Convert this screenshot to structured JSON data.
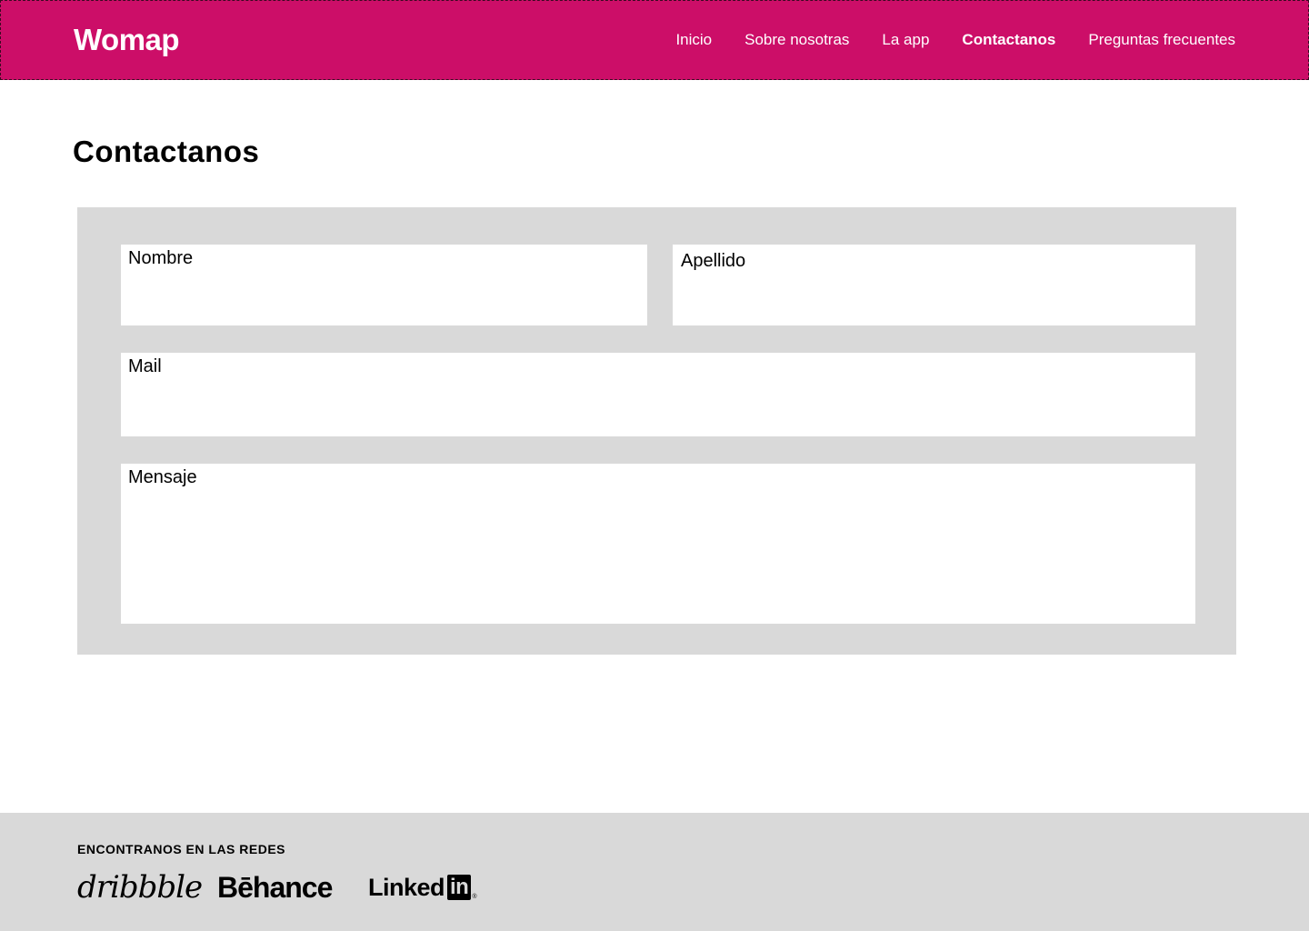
{
  "brand": {
    "name": "Womap",
    "color": "#CC0E68"
  },
  "nav": {
    "items": [
      {
        "label": "Inicio",
        "active": false
      },
      {
        "label": "Sobre nosotras",
        "active": false
      },
      {
        "label": "La app",
        "active": false
      },
      {
        "label": "Contactanos",
        "active": true
      },
      {
        "label": "Preguntas frecuentes",
        "active": false
      }
    ]
  },
  "page": {
    "title": "Contactanos"
  },
  "form": {
    "nombre": {
      "label": "Nombre",
      "value": ""
    },
    "apellido": {
      "label": "Apellido",
      "value": ""
    },
    "mail": {
      "label": "Mail",
      "value": ""
    },
    "mensaje": {
      "label": "Mensaje",
      "value": ""
    }
  },
  "footer": {
    "title": "ENCONTRANOS EN LAS REDES",
    "social": {
      "dribbble": "dribbble",
      "behance": "Bēhance",
      "linkedin_text": "Linked",
      "linkedin_box": "in",
      "linkedin_reg": "®"
    }
  }
}
